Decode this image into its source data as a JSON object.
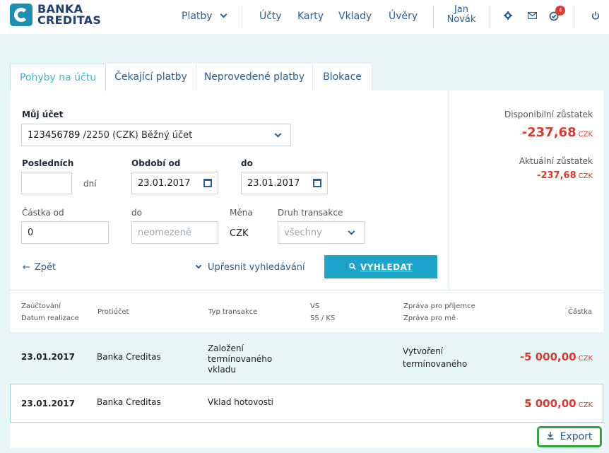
{
  "brand": {
    "line1": "BANKA",
    "line2": "CREDITAS"
  },
  "nav": {
    "platby": "Platby",
    "ucty": "Účty",
    "karty": "Karty",
    "vklady": "Vklady",
    "uvery": "Úvěry"
  },
  "user": {
    "first": "Jan",
    "last": "Novák"
  },
  "notifications": {
    "count": "4"
  },
  "tabs": [
    {
      "label": "Pohyby na účtu"
    },
    {
      "label": "Čekající platby"
    },
    {
      "label": "Neprovedené platby"
    },
    {
      "label": "Blokace"
    }
  ],
  "filter": {
    "account_label": "Můj účet",
    "account_number": "123456789",
    "account_rest": " /2250 (CZK) Běžný účet",
    "last_label": "Posledních",
    "last_value": "",
    "days_label": "dní",
    "period_from_label": "Období od",
    "period_from": "23.01.2017",
    "period_to_label": "do",
    "period_to": "23.01.2017",
    "amount_from_label": "Částka od",
    "amount_from": "0",
    "amount_to_label": "do",
    "amount_to_placeholder": "neomezeně",
    "currency_label": "Měna",
    "currency": "CZK",
    "type_label": "Druh transakce",
    "type_value": "všechny",
    "back": "Zpět",
    "refine": "Upřesnit vyhledávání",
    "search": "VYHLEDAT"
  },
  "balance": {
    "available_label": "Disponibilní zůstatek",
    "available_value": "-237,68",
    "current_label": "Aktuální zůstatek",
    "current_value": "-237,68",
    "currency": "CZK"
  },
  "table": {
    "headers": {
      "booking": "Zaúčtování",
      "realization": "Datum realizace",
      "counterparty": "Protiúčet",
      "type": "Typ transakce",
      "vs": "VS",
      "ssks": "SS / KS",
      "msg_recipient": "Zpráva pro příjemce",
      "msg_me": "Zpráva pro mě",
      "amount": "Částka"
    },
    "rows": [
      {
        "date": "23.01.2017",
        "counterparty": "Banka Creditas",
        "type": "Založení termínovaného vkladu",
        "message": "Vytvoření termínovaného",
        "amount": "-5 000,00",
        "currency": "CZK"
      },
      {
        "date": "23.01.2017",
        "counterparty": "Banka Creditas",
        "type": "Vklad hotovosti",
        "message": "",
        "amount": "5 000,00",
        "currency": "CZK"
      }
    ]
  },
  "export": {
    "label": "Export"
  }
}
